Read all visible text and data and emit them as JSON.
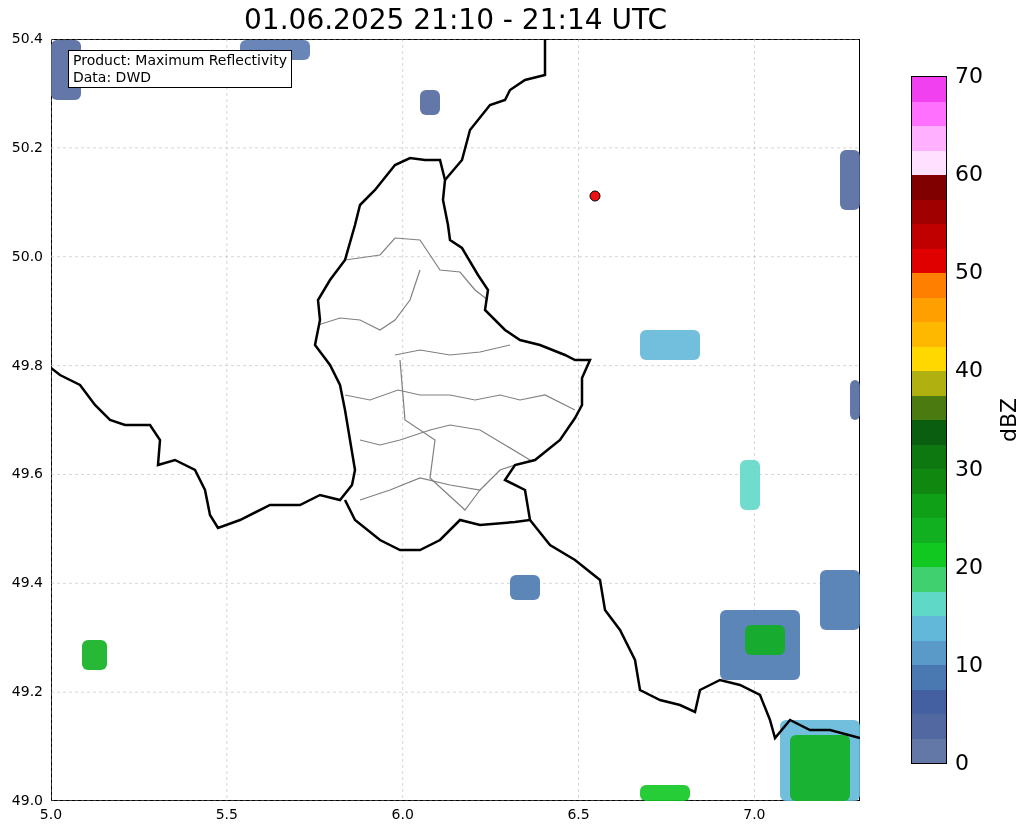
{
  "title": "01.06.2025 21:10 - 21:14 UTC",
  "legend": [
    "Product: Maximum Reflectivity",
    "Data: DWD"
  ],
  "map": {
    "x_ticks": [
      "5.0",
      "5.5",
      "6.0",
      "6.5",
      "7.0"
    ],
    "y_ticks": [
      "50.4",
      "50.2",
      "50.0",
      "49.8",
      "49.6",
      "49.4",
      "49.2",
      "49.0"
    ]
  },
  "colorbar": {
    "label": "dBZ",
    "ticks": [
      "70",
      "60",
      "50",
      "40",
      "30",
      "20",
      "10",
      "0"
    ],
    "segments": [
      {
        "color": "#6478a8"
      },
      {
        "color": "#5268a0"
      },
      {
        "color": "#4560a0"
      },
      {
        "color": "#4a78b0"
      },
      {
        "color": "#5a9ac8"
      },
      {
        "color": "#62b8d8"
      },
      {
        "color": "#60d8c8"
      },
      {
        "color": "#40d070"
      },
      {
        "color": "#10c820"
      },
      {
        "color": "#10b020"
      },
      {
        "color": "#10a018"
      },
      {
        "color": "#108810"
      },
      {
        "color": "#0e7810"
      },
      {
        "color": "#0a5e10"
      },
      {
        "color": "#4a7a10"
      },
      {
        "color": "#b0b010"
      },
      {
        "color": "#ffd800"
      },
      {
        "color": "#ffb800"
      },
      {
        "color": "#ffa000"
      },
      {
        "color": "#ff8000"
      },
      {
        "color": "#e00000"
      },
      {
        "color": "#c00000"
      },
      {
        "color": "#a00000"
      },
      {
        "color": "#800000"
      },
      {
        "color": "#ffe0ff"
      },
      {
        "color": "#ffb0ff"
      },
      {
        "color": "#ff70ff"
      },
      {
        "color": "#f040f0"
      }
    ]
  }
}
